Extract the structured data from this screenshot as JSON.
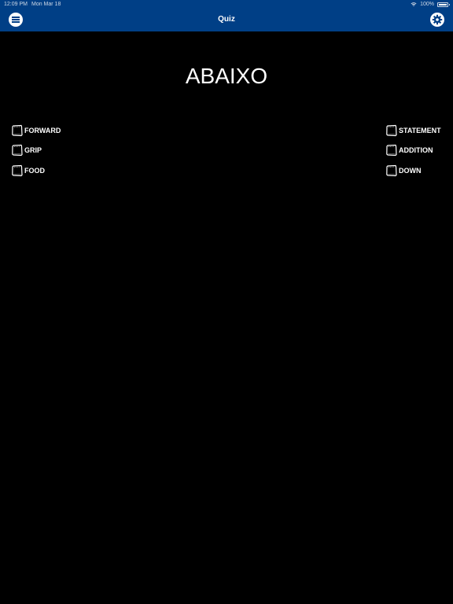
{
  "status_bar": {
    "time": "12:09 PM",
    "date": "Mon Mar 18",
    "battery": "100%"
  },
  "header": {
    "title": "Quiz",
    "background": "#003f86",
    "menu_icon": "menu-icon",
    "settings_icon": "gear-icon"
  },
  "quiz": {
    "word": "ABAIXO",
    "left_options": [
      {
        "label": "FORWARD"
      },
      {
        "label": "GRIP"
      },
      {
        "label": "FOOD"
      }
    ],
    "right_options": [
      {
        "label": "STATEMENT"
      },
      {
        "label": "ADDITION"
      },
      {
        "label": "DOWN"
      }
    ],
    "checkbox_icon": "checkbox-icon"
  }
}
